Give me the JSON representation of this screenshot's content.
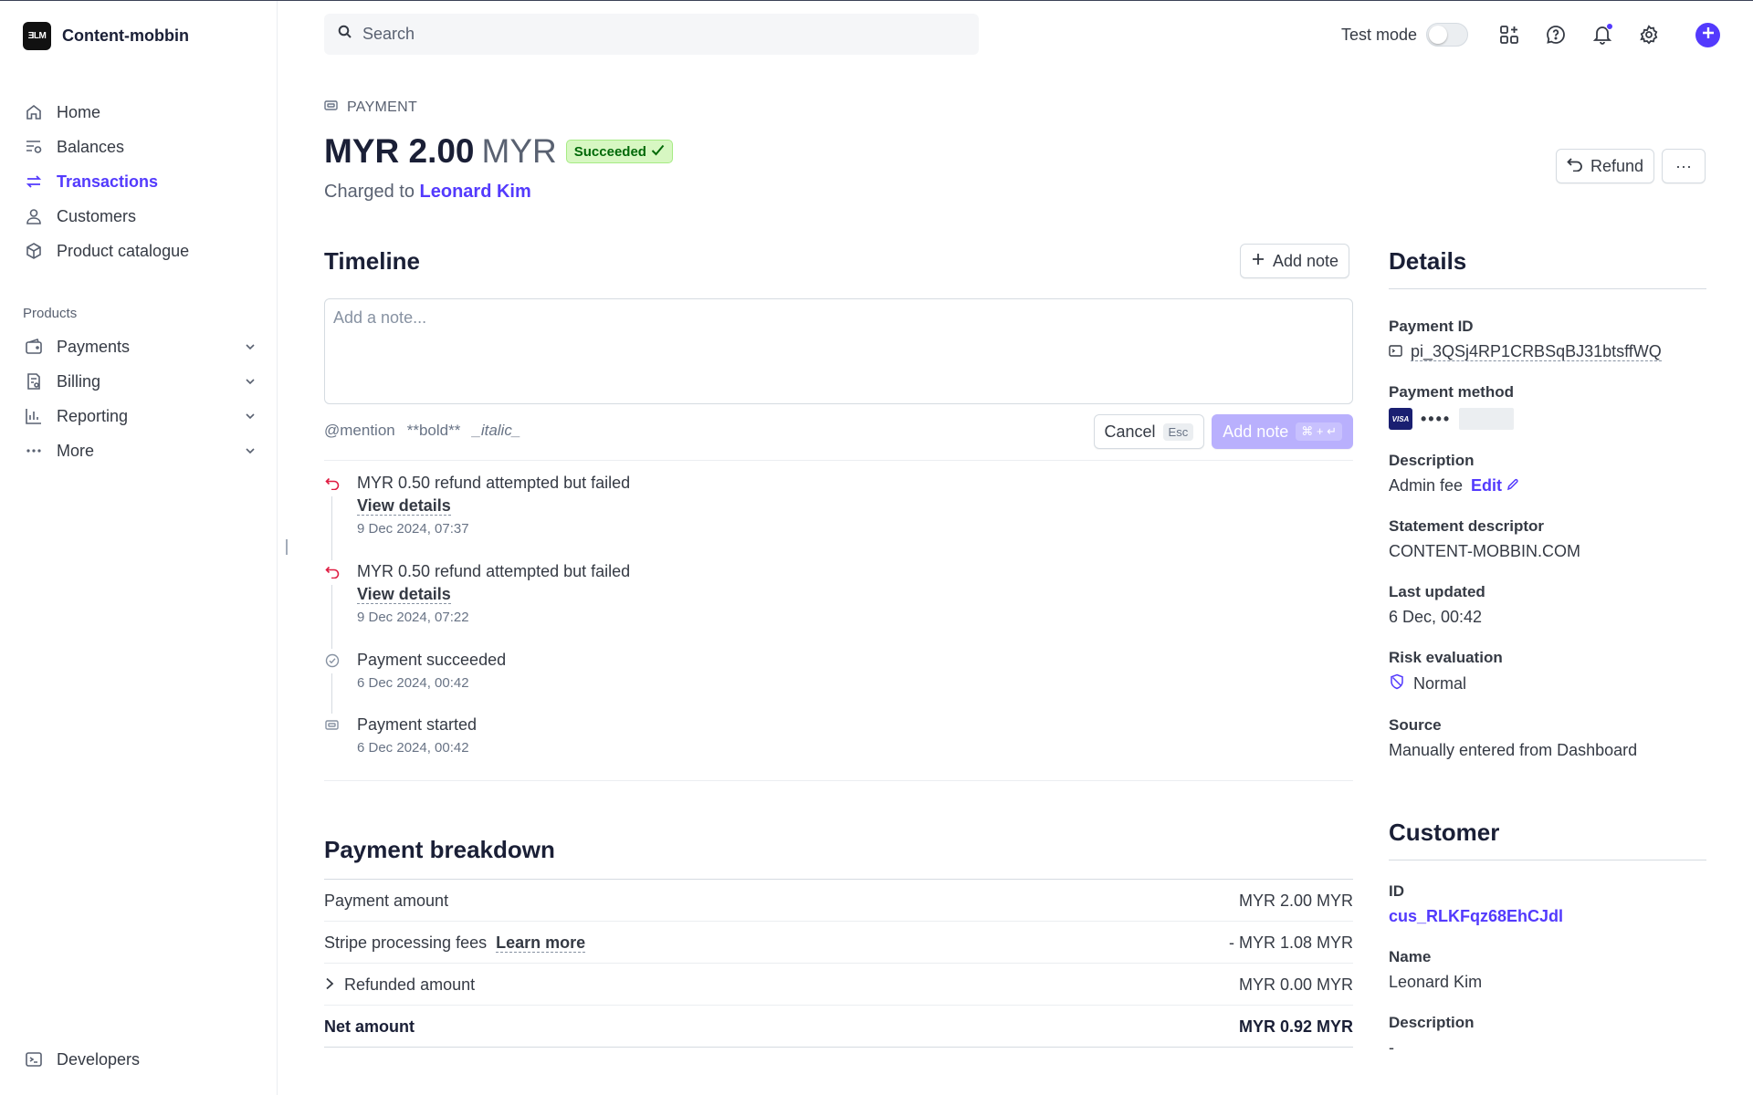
{
  "account": {
    "logo_text": "ƎLM",
    "name": "Content-mobbin"
  },
  "sidebar": {
    "items": [
      {
        "label": "Home",
        "icon": "home-icon"
      },
      {
        "label": "Balances",
        "icon": "balances-icon"
      },
      {
        "label": "Transactions",
        "icon": "transactions-icon",
        "active": true
      },
      {
        "label": "Customers",
        "icon": "customers-icon"
      },
      {
        "label": "Product catalogue",
        "icon": "product-icon"
      }
    ],
    "section_label": "Products",
    "products": [
      {
        "label": "Payments",
        "icon": "payments-icon"
      },
      {
        "label": "Billing",
        "icon": "billing-icon"
      },
      {
        "label": "Reporting",
        "icon": "reporting-icon"
      },
      {
        "label": "More",
        "icon": "more-icon"
      }
    ],
    "developers_label": "Developers"
  },
  "topbar": {
    "search_placeholder": "Search",
    "test_mode_label": "Test mode",
    "test_mode_on": false,
    "accent_color": "#533afd"
  },
  "header": {
    "breadcrumb": "PAYMENT",
    "amount": "MYR 2.00",
    "currency": "MYR",
    "status": "Succeeded",
    "charged_prefix": "Charged to",
    "customer_name": "Leonard Kim",
    "refund_label": "Refund",
    "more_label": "···"
  },
  "timeline": {
    "title": "Timeline",
    "add_note_label": "Add note",
    "note_placeholder": "Add a note...",
    "format_hints": {
      "mention": "@mention",
      "bold": "**bold**",
      "italic": "_italic_"
    },
    "cancel_label": "Cancel",
    "cancel_key": "Esc",
    "submit_label": "Add note",
    "submit_key": "⌘ + ↵",
    "events": [
      {
        "title": "MYR 0.50 refund attempted but failed",
        "link": "View details",
        "time": "9 Dec 2024, 07:37",
        "icon": "refund-icon"
      },
      {
        "title": "MYR 0.50 refund attempted but failed",
        "link": "View details",
        "time": "9 Dec 2024, 07:22",
        "icon": "refund-icon"
      },
      {
        "title": "Payment succeeded",
        "time": "6 Dec 2024, 00:42",
        "icon": "check-circle-icon"
      },
      {
        "title": "Payment started",
        "time": "6 Dec 2024, 00:42",
        "icon": "payment-icon"
      }
    ]
  },
  "breakdown": {
    "title": "Payment breakdown",
    "rows": [
      {
        "label": "Payment amount",
        "value": "MYR 2.00 MYR"
      },
      {
        "label": "Stripe processing fees",
        "link": "Learn more",
        "value": "- MYR 1.08 MYR"
      },
      {
        "label": "Refunded amount",
        "value": "MYR 0.00 MYR",
        "expandable": true
      },
      {
        "label": "Net amount",
        "value": "MYR 0.92 MYR",
        "total": true
      }
    ]
  },
  "details": {
    "title": "Details",
    "payment_id_label": "Payment ID",
    "payment_id": "pi_3QSj4RP1CRBSqBJ31btsffWQ",
    "payment_method_label": "Payment method",
    "card_brand": "VISA",
    "card_dots": "••••",
    "description_label": "Description",
    "description": "Admin fee",
    "edit_label": "Edit",
    "statement_label": "Statement descriptor",
    "statement": "CONTENT-MOBBIN.COM",
    "updated_label": "Last updated",
    "updated": "6 Dec, 00:42",
    "risk_label": "Risk evaluation",
    "risk": "Normal",
    "source_label": "Source",
    "source": "Manually entered from Dashboard"
  },
  "customer": {
    "title": "Customer",
    "id_label": "ID",
    "id": "cus_RLKFqz68EhCJdl",
    "name_label": "Name",
    "name": "Leonard Kim",
    "description_label": "Description",
    "description": "-"
  }
}
